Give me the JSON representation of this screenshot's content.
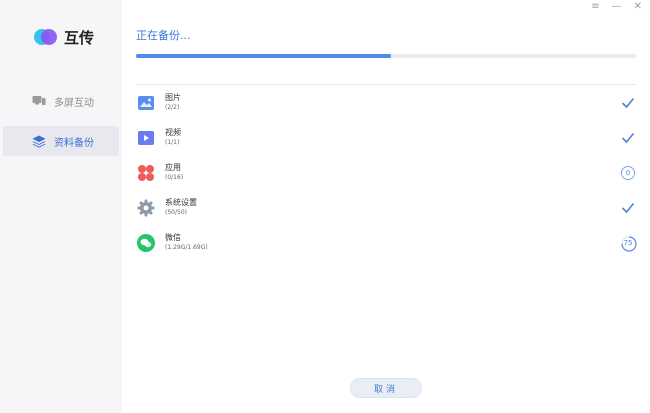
{
  "app": {
    "name": "互传"
  },
  "window_controls": {
    "menu": "≡",
    "minimize": "—",
    "close": "✕"
  },
  "sidebar": {
    "items": [
      {
        "label": "多屏互动",
        "icon": "multi-screen-icon",
        "active": false
      },
      {
        "label": "资料备份",
        "icon": "layers-icon",
        "active": true
      }
    ]
  },
  "main": {
    "title": "正在备份...",
    "progress": 0.51,
    "items": [
      {
        "name": "图片",
        "count": "(2/2)",
        "icon": "image-icon",
        "status": "done"
      },
      {
        "name": "视频",
        "count": "(1/1)",
        "icon": "video-icon",
        "status": "done"
      },
      {
        "name": "应用",
        "count": "(0/16)",
        "icon": "apps-icon",
        "status": "pending",
        "status_text": "0"
      },
      {
        "name": "系统设置",
        "count": "(50/50)",
        "icon": "settings-gear-icon",
        "status": "done"
      },
      {
        "name": "微信",
        "count": "(1.29G/1.69G)",
        "icon": "wechat-icon",
        "status": "progress",
        "status_text": "75",
        "status_value": 0.75
      }
    ],
    "cancel_label": "取消"
  },
  "colors": {
    "accent": "#3a76d8",
    "check": "#4f82d8",
    "sidebar_bg": "#f6f6f8"
  }
}
